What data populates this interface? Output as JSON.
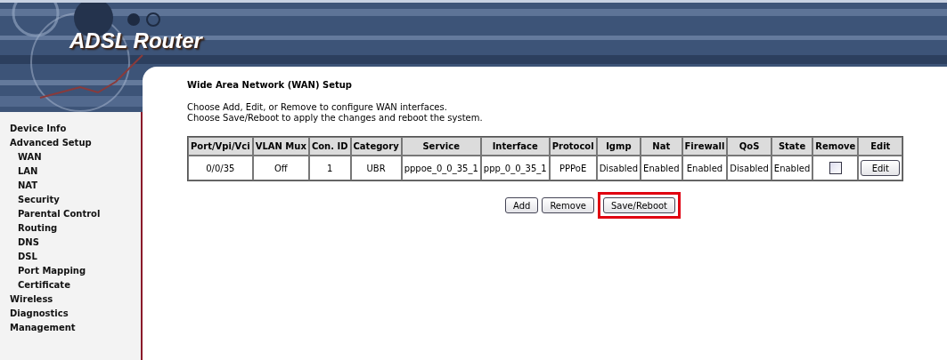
{
  "header": {
    "logo": "ADSL Router"
  },
  "sidebar": {
    "items": [
      {
        "label": "Device Info"
      },
      {
        "label": "Advanced Setup",
        "children": [
          {
            "label": "WAN"
          },
          {
            "label": "LAN"
          },
          {
            "label": "NAT"
          },
          {
            "label": "Security"
          },
          {
            "label": "Parental Control"
          },
          {
            "label": "Routing"
          },
          {
            "label": "DNS"
          },
          {
            "label": "DSL"
          },
          {
            "label": "Port Mapping"
          },
          {
            "label": "Certificate"
          }
        ]
      },
      {
        "label": "Wireless"
      },
      {
        "label": "Diagnostics"
      },
      {
        "label": "Management"
      }
    ]
  },
  "content": {
    "title": "Wide Area Network (WAN) Setup",
    "description": [
      "Choose Add, Edit, or Remove to configure WAN interfaces.",
      "Choose Save/Reboot to apply the changes and reboot the system."
    ],
    "table": {
      "columns": [
        "Port/Vpi/Vci",
        "VLAN Mux",
        "Con. ID",
        "Category",
        "Service",
        "Interface",
        "Protocol",
        "Igmp",
        "Nat",
        "Firewall",
        "QoS",
        "State",
        "Remove",
        "Edit"
      ],
      "rows": [
        {
          "cells": [
            "0/0/35",
            "Off",
            "1",
            "UBR",
            "pppoe_0_0_35_1",
            "ppp_0_0_35_1",
            "PPPoE",
            "Disabled",
            "Enabled",
            "Enabled",
            "Disabled",
            "Enabled"
          ],
          "remove_checked": false,
          "edit_label": "Edit"
        }
      ]
    },
    "buttons": [
      {
        "label": "Add",
        "highlighted": false
      },
      {
        "label": "Remove",
        "highlighted": false
      },
      {
        "label": "Save/Reboot",
        "highlighted": true
      }
    ]
  }
}
